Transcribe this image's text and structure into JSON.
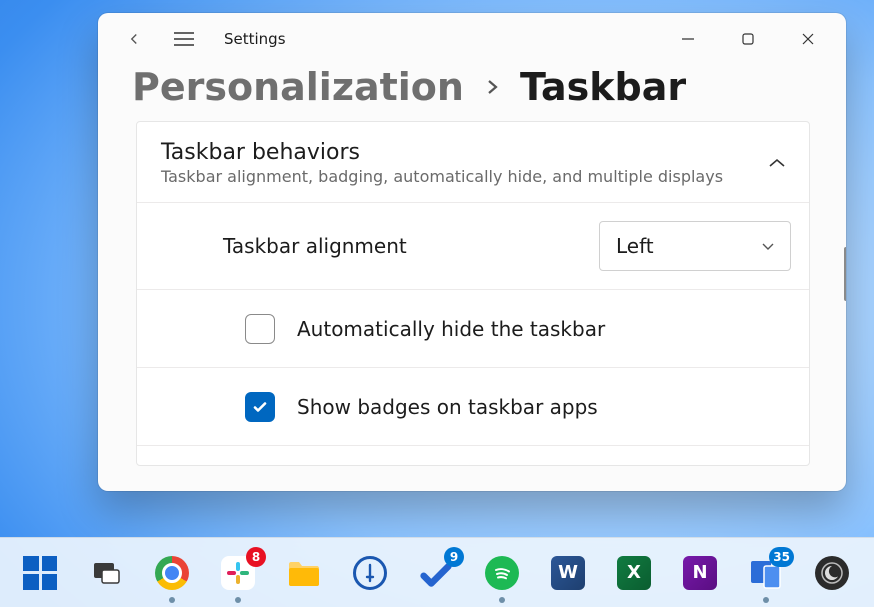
{
  "window": {
    "app_title": "Settings",
    "breadcrumb": {
      "parent": "Personalization",
      "current": "Taskbar"
    }
  },
  "panel": {
    "title": "Taskbar behaviors",
    "subtitle": "Taskbar alignment, badging, automatically hide, and multiple displays"
  },
  "rows": {
    "alignment": {
      "label": "Taskbar alignment",
      "value": "Left"
    },
    "auto_hide": {
      "label": "Automatically hide the taskbar",
      "checked": false
    },
    "badges": {
      "label": "Show badges on taskbar apps",
      "checked": true
    }
  },
  "taskbar": {
    "slack_badge": "8",
    "todo_badge": "9",
    "devices_badge": "35"
  }
}
